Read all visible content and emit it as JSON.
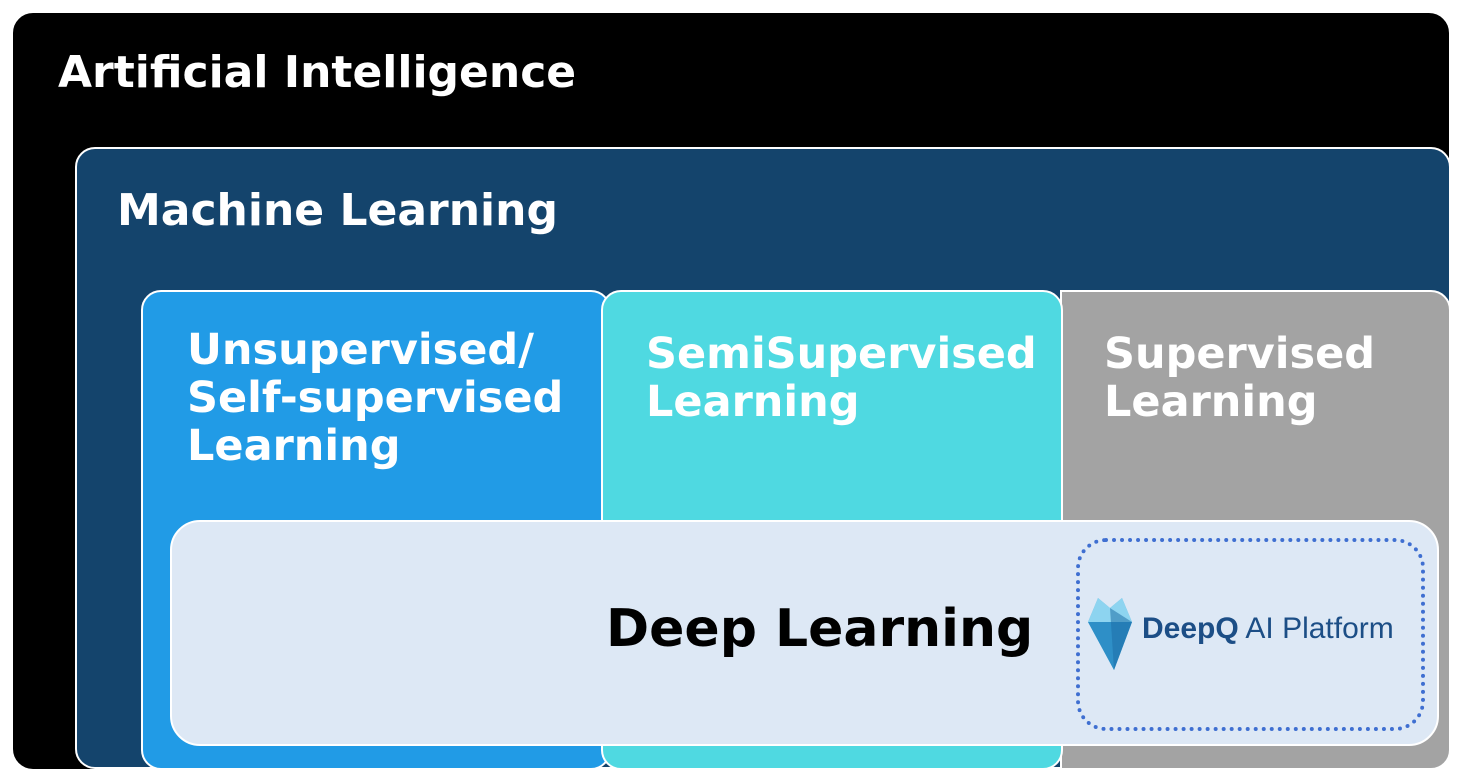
{
  "diagram": {
    "artificial_intelligence": {
      "label": "Artificial Intelligence",
      "color": "#000000"
    },
    "machine_learning": {
      "label": "Machine Learning",
      "color": "#14446c"
    },
    "unsupervised": {
      "label": "Unsupervised/\nSelf-supervised\nLearning",
      "color": "#219be6"
    },
    "semisupervised": {
      "label": "SemiSupervised\nLearning",
      "color": "#4fd9e1"
    },
    "supervised": {
      "label": "Supervised\nLearning",
      "color": "#a3a3a3"
    },
    "deep_learning": {
      "label": "Deep Learning",
      "color": "#dde8f5"
    },
    "logo": {
      "brand": "DeepQ",
      "product": " AI Platform",
      "icon": "crystal-icon",
      "color": "#1c4e86"
    }
  }
}
